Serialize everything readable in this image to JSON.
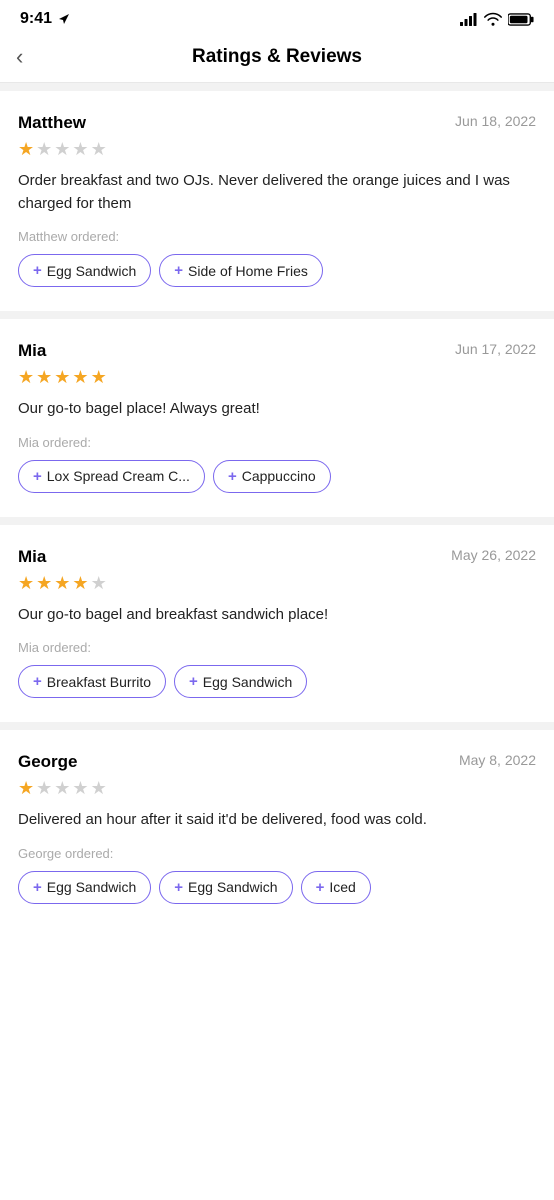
{
  "statusBar": {
    "time": "9:41",
    "timeIcon": "location-arrow"
  },
  "header": {
    "backLabel": "‹",
    "title": "Ratings & Reviews"
  },
  "reviews": [
    {
      "name": "Matthew",
      "date": "Jun 18, 2022",
      "stars": [
        true,
        false,
        false,
        false,
        false
      ],
      "text": "Order breakfast and two OJs. Never delivered the orange juices and I was charged for them",
      "orderedLabel": "Matthew ordered:",
      "items": [
        "Egg Sandwich",
        "Side of Home Fries"
      ]
    },
    {
      "name": "Mia",
      "date": "Jun 17, 2022",
      "stars": [
        true,
        true,
        true,
        true,
        true
      ],
      "text": "Our go-to bagel place! Always great!",
      "orderedLabel": "Mia ordered:",
      "items": [
        "Lox Spread Cream C...",
        "Cappuccino"
      ]
    },
    {
      "name": "Mia",
      "date": "May 26, 2022",
      "stars": [
        true,
        true,
        true,
        true,
        false
      ],
      "text": "Our go-to bagel and breakfast sandwich place!",
      "orderedLabel": "Mia ordered:",
      "items": [
        "Breakfast Burrito",
        "Egg Sandwich"
      ]
    },
    {
      "name": "George",
      "date": "May 8, 2022",
      "stars": [
        true,
        false,
        false,
        false,
        false
      ],
      "text": "Delivered an hour after it said it'd be delivered, food was cold.",
      "orderedLabel": "George ordered:",
      "items": [
        "Egg Sandwich",
        "Egg Sandwich",
        "Iced"
      ]
    }
  ],
  "plusSymbol": "+"
}
